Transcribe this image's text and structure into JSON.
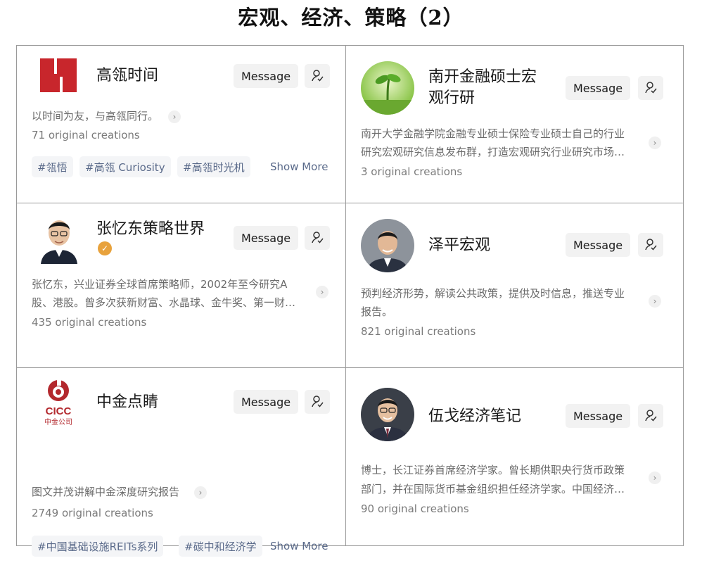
{
  "page": {
    "title": "宏观、经济、策略（2）"
  },
  "buttons": {
    "message": "Message"
  },
  "cards": [
    {
      "name": "高瓴时间",
      "desc": "以时间为友，与高瓴同行。",
      "count": "71 original creations",
      "tags": [
        "#瓴悟",
        "#高瓴 Curiosity",
        "#高瓴时光机"
      ],
      "show_more": "Show More"
    },
    {
      "name_line1": "南开金融硕士宏",
      "name_line2": "观行研",
      "desc_line1": "南开大学金融学院金融专业硕士保险专业硕士自己的行业",
      "desc_line2": "研究宏观研究信息发布群，打造宏观研究行业研究市场…",
      "count": "3 original creations"
    },
    {
      "name": "张忆东策略世界",
      "desc_line1": "张忆东，兴业证券全球首席策略师，2002年至今研究A",
      "desc_line2": "股、港股。曾多次获新财富、水晶球、金牛奖、第一财…",
      "count": "435 original creations"
    },
    {
      "name": "泽平宏观",
      "desc_line1": "预判经济形势，解读公共政策，提供及时信息，推送专业",
      "desc_line2": "报告。",
      "count": "821 original creations"
    },
    {
      "name": "中金点睛",
      "desc": "图文并茂讲解中金深度研究报告",
      "count": "2749 original creations",
      "tags": [
        "#中国基础设施REITs系列",
        "#碳中和经济学"
      ],
      "show_more": "Show More",
      "logo_text": "CICC",
      "logo_sub": "中金公司"
    },
    {
      "name": "伍戈经济笔记",
      "desc_line1": "博士，长江证券首席经济学家。曾长期供职央行货币政策",
      "desc_line2": "部门，并在国际货币基金组织担任经济学家。中国经济…",
      "count": "90 original creations"
    }
  ],
  "colors": {
    "hsbc_red": "#c8262c",
    "cicc_red": "#b3282d",
    "verified": "#e8a23c",
    "tag_text": "#5a6a8a"
  },
  "icons": [
    "follow-user-icon",
    "chevron-right-icon",
    "verified-badge-icon"
  ]
}
